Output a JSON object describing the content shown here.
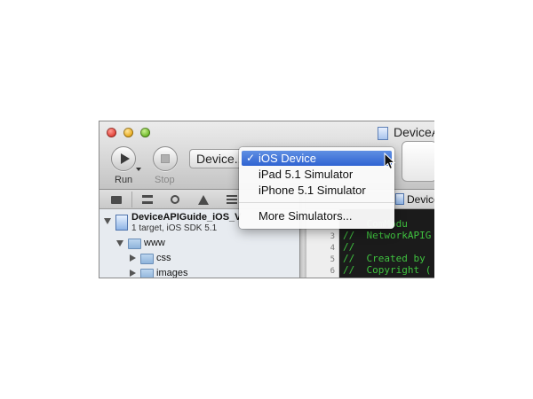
{
  "window": {
    "title": "DeviceA"
  },
  "toolbar": {
    "run_label": "Run",
    "stop_label": "Stop",
    "scheme_label": "Device..."
  },
  "menu": {
    "items": [
      {
        "label": "iOS Device",
        "checked": true,
        "highlighted": true
      },
      {
        "label": "iPad 5.1 Simulator"
      },
      {
        "label": "iPhone 5.1 Simulator"
      },
      {
        "label": "More Simulators..."
      }
    ],
    "checkmark": "✓"
  },
  "navigator": {
    "project_name": "DeviceAPIGuide_iOS_V",
    "project_subtitle": "1 target, iOS SDK 5.1",
    "folders": [
      {
        "name": "www",
        "expanded": true
      },
      {
        "name": "css",
        "expanded": false
      },
      {
        "name": "images",
        "expanded": false
      }
    ]
  },
  "editor": {
    "jump_label": "Device",
    "line_numbers": [
      "",
      "3",
      "4",
      "5",
      "6"
    ],
    "lines": [
      "    ComModu",
      "//  NetworkAPIG",
      "//",
      "//  Created by",
      "//  Copyright ("
    ]
  },
  "colors": {
    "menu_highlight": "#3a6fd8",
    "code_background": "#1b1b1b",
    "code_comment": "#3fc23f"
  }
}
